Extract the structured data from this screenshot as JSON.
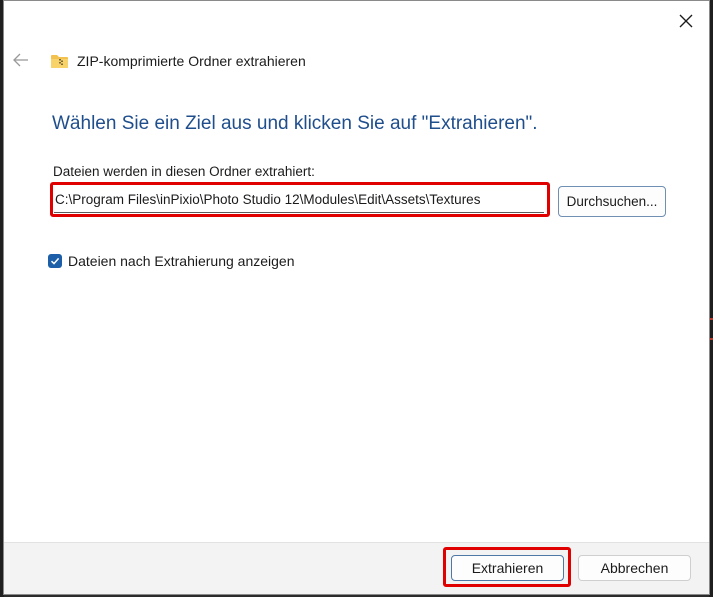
{
  "dialog": {
    "title": "ZIP-komprimierte Ordner extrahieren",
    "heading": "Wählen Sie ein Ziel aus und klicken Sie auf \"Extrahieren\".",
    "folder_label": "Dateien werden in diesen Ordner extrahiert:",
    "path_value": "C:\\Program Files\\inPixio\\Photo Studio 12\\Modules\\Edit\\Assets\\Textures",
    "browse_label": "Durchsuchen...",
    "checkbox_label": "Dateien nach Extrahierung anzeigen",
    "checkbox_checked": true,
    "extract_label": "Extrahieren",
    "cancel_label": "Abbrechen"
  },
  "icons": {
    "close": "close-icon",
    "back": "arrow-left-icon",
    "folder": "zip-folder-icon",
    "check": "checkmark-icon"
  },
  "colors": {
    "heading": "#1f4e8c",
    "checkbox": "#1c5fa8",
    "highlight": "#e00000",
    "footer": "#f3f3f3"
  }
}
